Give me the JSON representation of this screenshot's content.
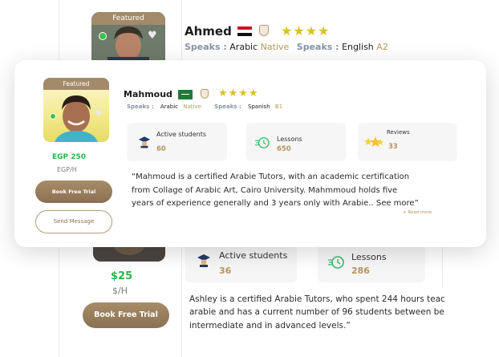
{
  "featured_label": "Featured",
  "tutor_top": {
    "name": "Ahmed",
    "rating": 4,
    "speaks_label": "Speaks :",
    "lang1": "Arabic",
    "lang1_level": "Native",
    "lang2": "English",
    "lang2_level": "A2"
  },
  "tutor_modal": {
    "name": "Mahmoud",
    "rating": 4,
    "speaks_label": "Speaks :",
    "lang1": "Arabic",
    "lang1_level": "Native",
    "lang2": "Spanish",
    "lang2_level": "B1",
    "price": "EGP 250",
    "per_hour": "EGP/H",
    "book_label": "Book Free Trial",
    "message_label": "Send Message",
    "stats": {
      "active_label": "Active students",
      "active_value": "60",
      "lessons_label": "Lessons",
      "lessons_value": "650",
      "reviews_label": "Reviews",
      "reviews_value": "33"
    },
    "description_lines": [
      "“Mahmoud is a certified Arabie Tutors, with an academic certification",
      "from Collage of Arabic Art, Cairo University. Mahmmoud holds five",
      "years of experience generally and 3 years only with Arabie.. See more”"
    ],
    "read_more": "+ Read more"
  },
  "tutor_bottom": {
    "price": "$25",
    "per_hour": "$/H",
    "book_label": "Book Free Trial",
    "stats": {
      "active_label": "Active students",
      "active_value": "36",
      "lessons_label": "Lessons",
      "lessons_value": "286"
    },
    "description_lines": [
      "Ashley is a certified Arabie Tutors, who spent 244 hours teac",
      "arabie and has a current number of 96 students between be",
      "intermediate and in advanced levels.”"
    ]
  },
  "colors": {
    "accent_gold": "#b8965e",
    "price_green": "#2db34a",
    "star_yellow": "#d8c02c",
    "online_green": "#3cc14b"
  }
}
